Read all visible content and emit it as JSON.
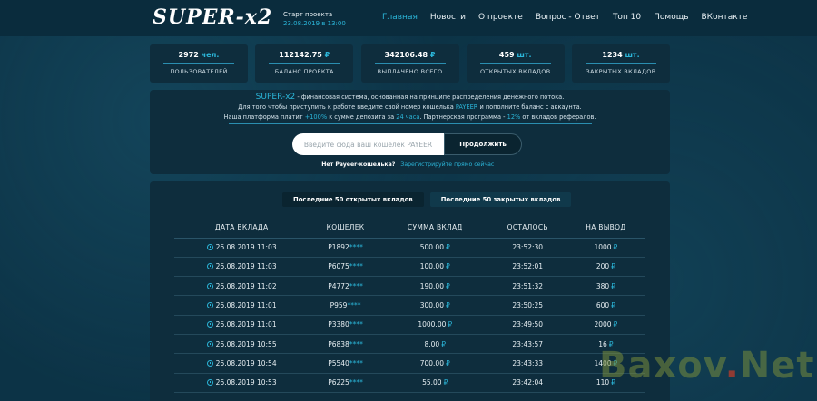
{
  "header": {
    "logo": "SUPER-x2",
    "start_title": "Старт проекта",
    "start_date": "23.08.2019 в 13:00",
    "nav": [
      {
        "label": "Главная",
        "active": true
      },
      {
        "label": "Новости"
      },
      {
        "label": "О проекте"
      },
      {
        "label": "Вопрос - Ответ"
      },
      {
        "label": "Топ 10"
      },
      {
        "label": "Помощь"
      },
      {
        "label": "ВКонтакте"
      }
    ]
  },
  "stats": [
    {
      "value": "2972",
      "unit": "чел.",
      "label": "ПОЛЬЗОВАТЕЛЕЙ"
    },
    {
      "value": "112142.75",
      "unit": "₽",
      "label": "БАЛАНС ПРОЕКТА"
    },
    {
      "value": "342106.48",
      "unit": "₽",
      "label": "ВЫПЛАЧЕНО ВСЕГО"
    },
    {
      "value": "459",
      "unit": "шт.",
      "label": "ОТКРЫТЫХ ВКЛАДОВ"
    },
    {
      "value": "1234",
      "unit": "шт.",
      "label": "ЗАКРЫТЫХ ВКЛАДОВ"
    }
  ],
  "hero": {
    "brand": "SUPER-x2",
    "line1_rest": " - финансовая система, основанная на принципе распределения денежного потока.",
    "line2_a": "Для того чтобы приступить к работе введите свой номер кошелька ",
    "line2_hl": "PAYEER",
    "line2_b": " и пополните баланс с аккаунта.",
    "line3_a": "Наша платформа платит ",
    "line3_hl1": "+100%",
    "line3_b": " к сумме депозита за ",
    "line3_hl2": "24 часа",
    "line3_c": ". Партнерская программа - ",
    "line3_hl3": "12%",
    "line3_d": " от вкладов рефералов.",
    "input_placeholder": "Введите сюда ваш кошелек PAYEER",
    "submit_label": "Продолжить",
    "no_wallet": "Нет Payeer-кошелька?",
    "register_link": "Зарегистрируйте прямо сейчас !"
  },
  "tabs": [
    {
      "label": "Последние 50 открытых вкладов",
      "active": true
    },
    {
      "label": "Последние 50 закрытых вкладов",
      "active": false
    }
  ],
  "table": {
    "headers": [
      "ДАТА ВКЛАДА",
      "КОШЕЛЕК",
      "СУММА ВКЛАД",
      "ОСТАЛОСЬ",
      "НА ВЫВОД"
    ],
    "rows": [
      {
        "date": "26.08.2019 11:03",
        "wallet": "P1892",
        "mask": "****",
        "sum": "500.00",
        "left": "23:52:30",
        "out": "1000"
      },
      {
        "date": "26.08.2019 11:03",
        "wallet": "P6075",
        "mask": "****",
        "sum": "100.00",
        "left": "23:52:01",
        "out": "200"
      },
      {
        "date": "26.08.2019 11:02",
        "wallet": "P4772",
        "mask": "****",
        "sum": "190.00",
        "left": "23:51:32",
        "out": "380"
      },
      {
        "date": "26.08.2019 11:01",
        "wallet": "P959",
        "mask": "****",
        "sum": "300.00",
        "left": "23:50:25",
        "out": "600"
      },
      {
        "date": "26.08.2019 11:01",
        "wallet": "P3380",
        "mask": "****",
        "sum": "1000.00",
        "left": "23:49:50",
        "out": "2000"
      },
      {
        "date": "26.08.2019 10:55",
        "wallet": "P6838",
        "mask": "****",
        "sum": "8.00",
        "left": "23:43:57",
        "out": "16"
      },
      {
        "date": "26.08.2019 10:54",
        "wallet": "P5540",
        "mask": "****",
        "sum": "700.00",
        "left": "23:43:33",
        "out": "1400"
      },
      {
        "date": "26.08.2019 10:53",
        "wallet": "P6225",
        "mask": "****",
        "sum": "55.00",
        "left": "23:42:04",
        "out": "110"
      }
    ],
    "currency": "₽"
  },
  "watermark": {
    "a": "Baxov",
    "dot": ".",
    "b": "Net"
  }
}
